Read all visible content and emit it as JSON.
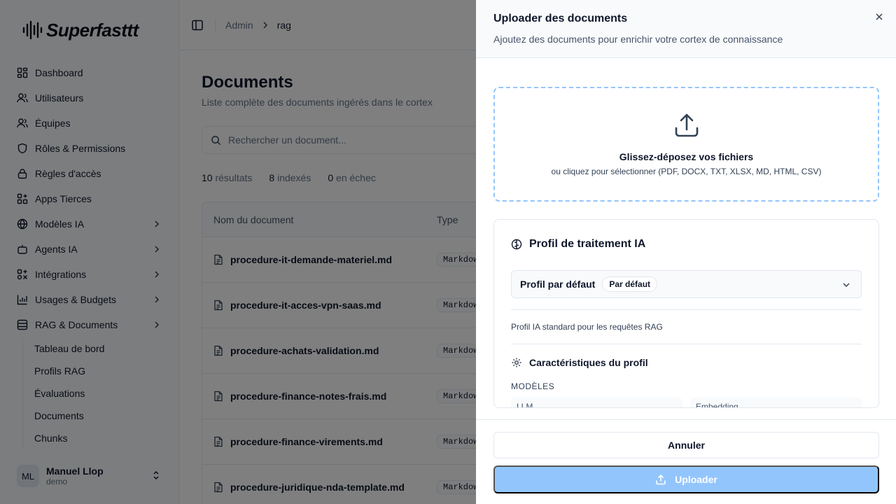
{
  "app": {
    "name": "Superfasttt"
  },
  "sidebar": {
    "items": [
      {
        "label": "Dashboard",
        "icon": "dashboard-icon",
        "has_submenu": false
      },
      {
        "label": "Utilisateurs",
        "icon": "user-icon",
        "has_submenu": false
      },
      {
        "label": "Équipes",
        "icon": "users-icon",
        "has_submenu": false
      },
      {
        "label": "Rôles & Permissions",
        "icon": "shield-icon",
        "has_submenu": false
      },
      {
        "label": "Règles d'accès",
        "icon": "lock-icon",
        "has_submenu": false
      },
      {
        "label": "Apps Tierces",
        "icon": "apps-icon",
        "has_submenu": false
      },
      {
        "label": "Modèles IA",
        "icon": "globe-icon",
        "has_submenu": true
      },
      {
        "label": "Agents IA",
        "icon": "bot-icon",
        "has_submenu": true
      },
      {
        "label": "Intégrations",
        "icon": "integrations-icon",
        "has_submenu": true
      },
      {
        "label": "Usages & Budgets",
        "icon": "bar-chart-icon",
        "has_submenu": true
      },
      {
        "label": "RAG & Documents",
        "icon": "database-icon",
        "has_submenu": true
      }
    ],
    "subitems": [
      "Tableau de bord",
      "Profils RAG",
      "Évaluations",
      "Documents",
      "Chunks"
    ],
    "user": {
      "initials": "ML",
      "name": "Manuel Llop",
      "org": "demo"
    }
  },
  "breadcrumb": {
    "parent": "Admin",
    "current": "rag"
  },
  "page": {
    "title": "Documents",
    "subtitle": "Liste complète des documents ingérés dans le cortex",
    "search_placeholder": "Rechercher un document...",
    "stats": [
      {
        "value": "10",
        "label": "résultats"
      },
      {
        "value": "8",
        "label": "indexés"
      },
      {
        "value": "0",
        "label": "en échec"
      }
    ],
    "table": {
      "columns": [
        "Nom du document",
        "Type"
      ],
      "rows": [
        {
          "name": "procedure-it-demande-materiel.md",
          "type": "Markdown"
        },
        {
          "name": "procedure-it-acces-vpn-saas.md",
          "type": "Markdown"
        },
        {
          "name": "procedure-achats-validation.md",
          "type": "Markdown"
        },
        {
          "name": "procedure-finance-notes-frais.md",
          "type": "Markdown"
        },
        {
          "name": "procedure-finance-virements.md",
          "type": "Markdown"
        },
        {
          "name": "procedure-juridique-nda-template.md",
          "type": "Markdown"
        }
      ]
    }
  },
  "sheet": {
    "title": "Uploader des documents",
    "description": "Ajoutez des documents pour enrichir votre cortex de connaissance",
    "dropzone": {
      "title": "Glissez-déposez vos fichiers",
      "subtitle": "ou cliquez pour sélectionner (PDF, DOCX, TXT, XLSX, MD, HTML, CSV)"
    },
    "profile_card": {
      "title": "Profil de traitement IA",
      "select_value": "Profil par défaut",
      "select_badge": "Par défaut",
      "description": "Profil IA standard pour les requêtes RAG",
      "features_title": "Caractéristiques du profil",
      "models_label": "MODÈLES",
      "model_boxes": [
        "LLM",
        "Embedding"
      ]
    },
    "cancel_label": "Annuler",
    "upload_label": "Uploader"
  },
  "colors": {
    "accent": "#93c5fd",
    "overlay": "rgba(0,0,0,0.5)"
  }
}
